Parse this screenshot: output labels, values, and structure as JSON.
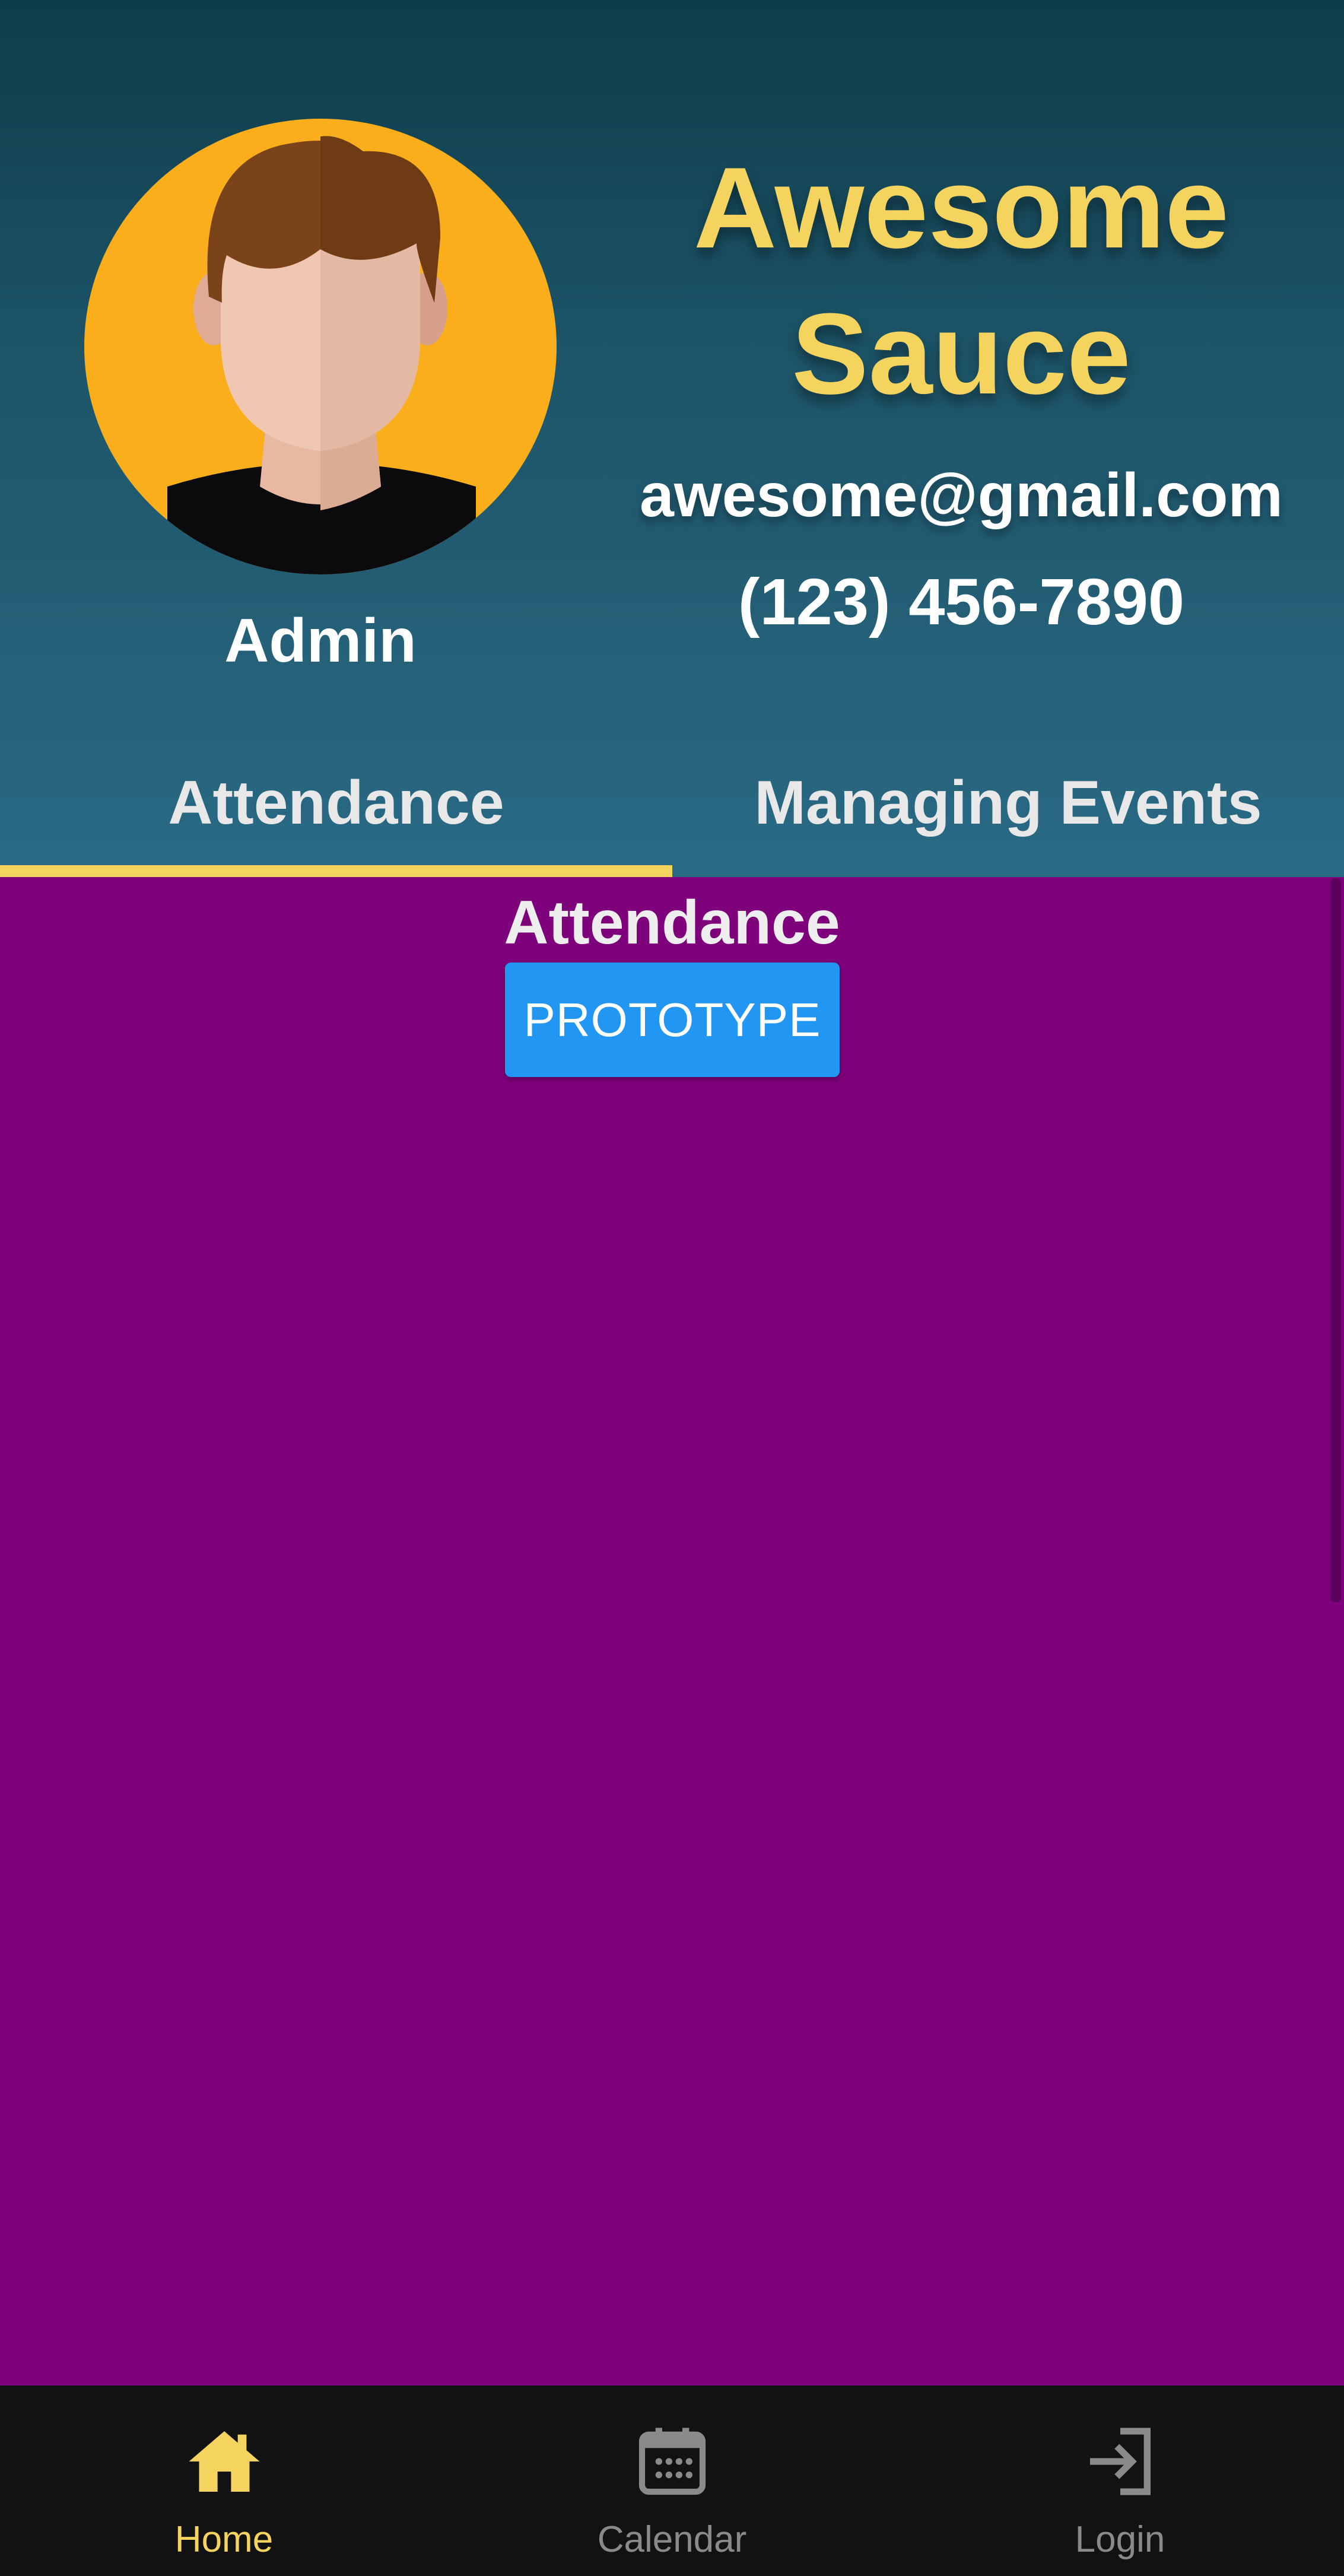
{
  "profile": {
    "name": "Awesome Sauce",
    "email": "awesome@gmail.com",
    "phone": "(123) 456-7890",
    "role": "Admin",
    "avatar_icon": "user-avatar-icon"
  },
  "tabs": [
    {
      "label": "Attendance",
      "selected": true
    },
    {
      "label": "Managing Events",
      "selected": false
    }
  ],
  "content": {
    "title": "Attendance",
    "button_label": "PROTOTYPE"
  },
  "bottom_nav": [
    {
      "label": "Home",
      "icon": "home-icon",
      "active": true
    },
    {
      "label": "Calendar",
      "icon": "calendar-icon",
      "active": false
    },
    {
      "label": "Login",
      "icon": "login-icon",
      "active": false
    }
  ],
  "colors": {
    "accent": "#f4d35e",
    "header_top": "#0e3c4a",
    "header_bottom": "#2a6a85",
    "content_bg": "#7e007b",
    "button": "#2196f3",
    "nav_bg": "#121212"
  }
}
